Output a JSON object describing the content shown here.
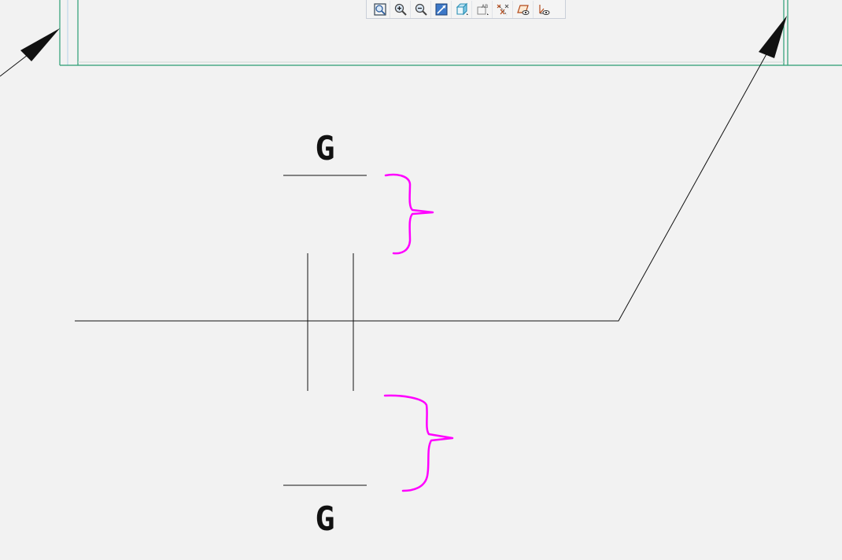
{
  "window": {
    "title": ""
  },
  "toolbar": {
    "buttons": [
      {
        "name": "zoom-fit-icon"
      },
      {
        "name": "zoom-in-icon"
      },
      {
        "name": "zoom-out-icon"
      },
      {
        "name": "zoom-window-icon"
      },
      {
        "name": "view-orientation-icon"
      },
      {
        "name": "annotation-display-icon"
      },
      {
        "name": "datum-display-icon"
      },
      {
        "name": "plane-display-icon"
      },
      {
        "name": "csys-display-icon"
      }
    ]
  },
  "drawing": {
    "datum_top_label": "G",
    "datum_bottom_label": "G",
    "colors": {
      "line": "#111111",
      "frame": "#2a9d73",
      "markup": "#ff00ff",
      "background": "#f2f2f2"
    }
  }
}
